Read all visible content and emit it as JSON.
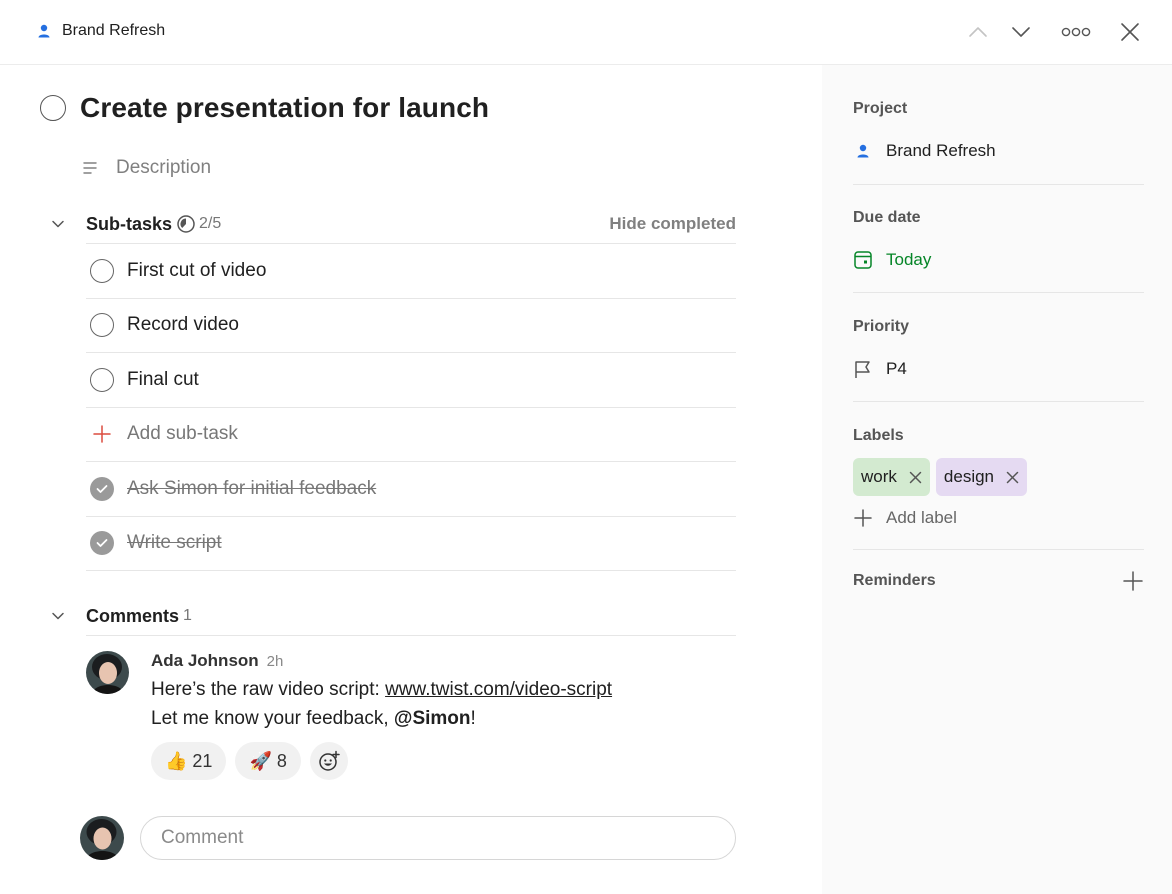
{
  "header": {
    "project_name": "Brand Refresh",
    "icons": [
      "person-icon",
      "chevron-up-icon",
      "chevron-down-icon",
      "more-horizontal-icon",
      "close-icon"
    ]
  },
  "task": {
    "title": "Create presentation for launch",
    "description_placeholder": "Description"
  },
  "subtasks": {
    "title": "Sub-tasks",
    "count": "2/5",
    "hide_completed_label": "Hide completed",
    "open_items": [
      {
        "label": "First cut of video"
      },
      {
        "label": "Record video"
      },
      {
        "label": "Final cut"
      }
    ],
    "add_label": "Add sub-task",
    "completed_items": [
      {
        "label": "Ask Simon for initial feedback"
      },
      {
        "label": "Write script"
      }
    ]
  },
  "comments": {
    "title": "Comments",
    "count": "1",
    "items": [
      {
        "author": "Ada Johnson",
        "time": "2h",
        "line1_prefix": "Here’s the raw video script: ",
        "link": "www.twist.com/video-script",
        "line2_prefix": "Let me know your feedback, ",
        "mention": "@Simon",
        "line2_suffix": "!",
        "reactions": [
          {
            "emoji": "👍",
            "count": "21"
          },
          {
            "emoji": "🚀",
            "count": "8"
          }
        ]
      }
    ],
    "input_placeholder": "Comment"
  },
  "sidebar": {
    "project": {
      "label": "Project",
      "value": "Brand Refresh"
    },
    "due_date": {
      "label": "Due date",
      "value": "Today"
    },
    "priority": {
      "label": "Priority",
      "value": "P4"
    },
    "labels": {
      "label": "Labels",
      "items": [
        {
          "name": "work",
          "color": "#d3ead0"
        },
        {
          "name": "design",
          "color": "#e5daf2"
        }
      ],
      "add_label": "Add label"
    },
    "reminders": {
      "label": "Reminders"
    }
  },
  "colors": {
    "accent_blue": "#246fe0",
    "due_green": "#058527",
    "add_red": "#dc4c3e"
  }
}
